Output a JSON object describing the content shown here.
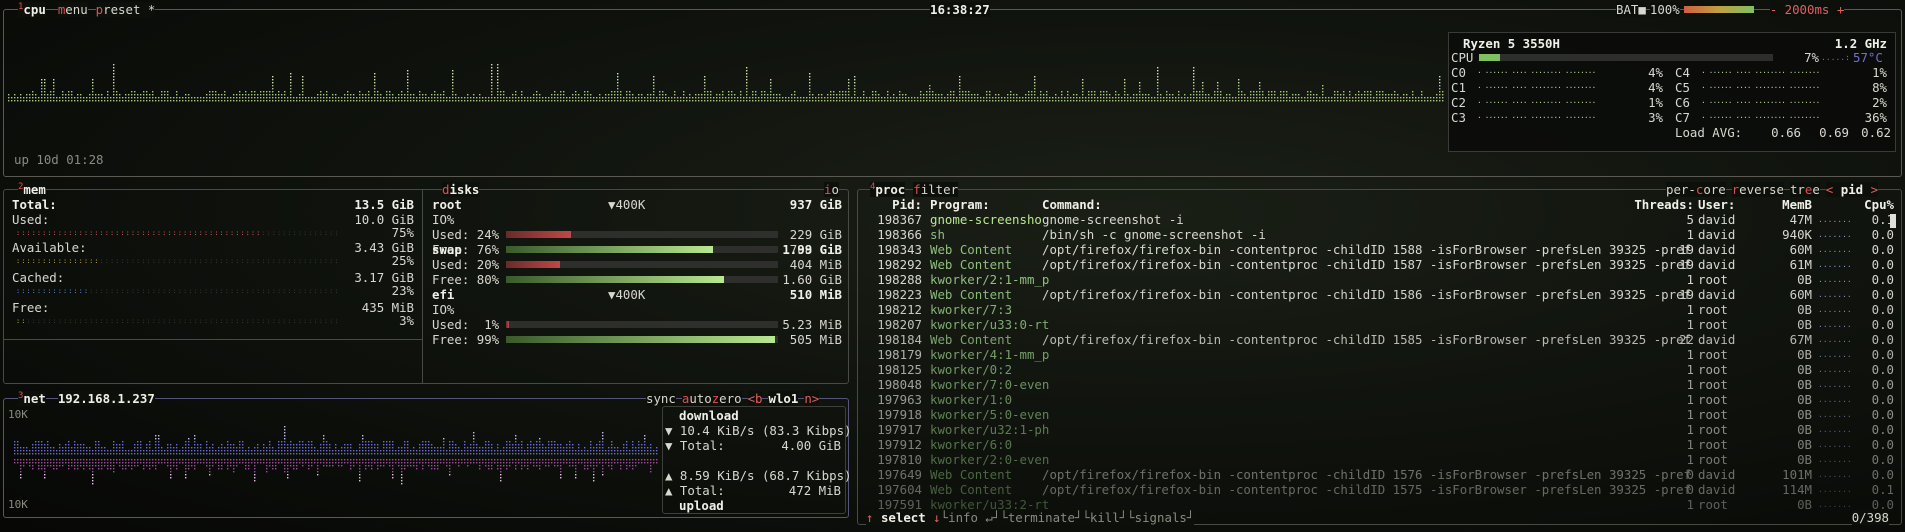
{
  "cpu": {
    "title": "cpu",
    "title_num": "1",
    "menu": "menu",
    "preset": "preset *",
    "clock": "16:38:27",
    "battery_label": "BAT",
    "battery_pct": "100%",
    "battery_fraction": 1.0,
    "interval": "- 2000ms +",
    "uptime": "up 10d 01:28",
    "model": "Ryzen 5 3550H",
    "freq": "1.2 GHz",
    "total": {
      "label": "CPU",
      "pct": "7%",
      "fraction": 0.07,
      "temp": "57°C"
    },
    "cores": [
      {
        "label": "C0",
        "pct": "4%"
      },
      {
        "label": "C1",
        "pct": "4%"
      },
      {
        "label": "C2",
        "pct": "1%"
      },
      {
        "label": "C3",
        "pct": "3%"
      },
      {
        "label": "C4",
        "pct": "1%"
      },
      {
        "label": "C5",
        "pct": "8%"
      },
      {
        "label": "C6",
        "pct": "2%"
      },
      {
        "label": "C7",
        "pct": "36%"
      }
    ],
    "load_label": "Load AVG:",
    "load": [
      "0.66",
      "0.69",
      "0.62"
    ]
  },
  "mem": {
    "title": "mem",
    "title_num": "2",
    "total_label": "Total:",
    "total": "13.5 GiB",
    "used_label": "Used:",
    "used": "10.0 GiB",
    "used_pct": "75%",
    "used_fraction": 0.75,
    "avail_label": "Available:",
    "avail": "3.43 GiB",
    "avail_pct": "25%",
    "avail_fraction": 0.25,
    "cached_label": "Cached:",
    "cached": "3.17 GiB",
    "cached_pct": "23%",
    "cached_fraction": 0.23,
    "free_label": "Free:",
    "free": "435 MiB",
    "free_pct": "3%",
    "free_fraction": 0.03
  },
  "disks": {
    "title": "disks",
    "io": "io",
    "items": [
      {
        "name": "root",
        "io_rate": "▼400K",
        "size": "937 GiB",
        "io_label": "IO%",
        "used_label": "Used: 24%",
        "used": "229 GiB",
        "used_fraction": 0.24,
        "free_label": "Free: 76%",
        "free": "708 GiB",
        "free_fraction": 0.76
      },
      {
        "name": "swap",
        "io_rate": "",
        "size": "1.99 GiB",
        "io_label": "",
        "used_label": "Used: 20%",
        "used": "404 MiB",
        "used_fraction": 0.2,
        "free_label": "Free: 80%",
        "free": "1.60 GiB",
        "free_fraction": 0.8
      },
      {
        "name": "efi",
        "io_rate": "▼400K",
        "size": "510 MiB",
        "io_label": "IO%",
        "used_label": "Used:  1%",
        "used": "5.23 MiB",
        "used_fraction": 0.01,
        "free_label": "Free: 99%",
        "free": "505 MiB",
        "free_fraction": 0.99
      }
    ]
  },
  "net": {
    "title": "net",
    "title_num": "3",
    "ip": "192.168.1.237",
    "sync": "sync",
    "auto": "auto",
    "zero": "zero",
    "prev": "<b",
    "iface": "wlo1",
    "next": "n>",
    "scale_top": "10K",
    "scale_bottom": "10K",
    "download_label": "download",
    "down_rate": "▼ 10.4 KiB/s (83.3 Kibps)",
    "down_total_label": "▼ Total:",
    "down_total": "4.00 GiB",
    "up_rate": "▲ 8.59 KiB/s (68.7 Kibps)",
    "up_total_label": "▲ Total:",
    "up_total": "472 MiB",
    "upload_label": "upload"
  },
  "proc": {
    "title": "proc",
    "title_num": "4",
    "filter": "filter",
    "options": [
      "per-core",
      "reverse",
      "tree",
      "< pid >"
    ],
    "headers": {
      "pid": "Pid:",
      "program": "Program:",
      "command": "Command:",
      "threads": "Threads:",
      "user": "User:",
      "mem": "MemB",
      "cpu": "Cpu%"
    },
    "rows": [
      {
        "pid": "198367",
        "program": "gnome-screensho",
        "command": "gnome-screenshot -i",
        "threads": "5",
        "user": "david",
        "mem": "47M",
        "cpu": "0.1"
      },
      {
        "pid": "198366",
        "program": "sh",
        "command": "/bin/sh -c gnome-screenshot -i",
        "threads": "1",
        "user": "david",
        "mem": "940K",
        "cpu": "0.0"
      },
      {
        "pid": "198343",
        "program": "Web Content",
        "command": "/opt/firefox/firefox-bin -contentproc -childID 1588 -isForBrowser -prefsLen 39325 -pref",
        "threads": "19",
        "user": "david",
        "mem": "60M",
        "cpu": "0.0"
      },
      {
        "pid": "198292",
        "program": "Web Content",
        "command": "/opt/firefox/firefox-bin -contentproc -childID 1587 -isForBrowser -prefsLen 39325 -pref",
        "threads": "19",
        "user": "david",
        "mem": "61M",
        "cpu": "0.0"
      },
      {
        "pid": "198288",
        "program": "kworker/2:1-mm_p",
        "command": "",
        "threads": "1",
        "user": "root",
        "mem": "0B",
        "cpu": "0.0"
      },
      {
        "pid": "198223",
        "program": "Web Content",
        "command": "/opt/firefox/firefox-bin -contentproc -childID 1586 -isForBrowser -prefsLen 39325 -pref",
        "threads": "19",
        "user": "david",
        "mem": "60M",
        "cpu": "0.0"
      },
      {
        "pid": "198212",
        "program": "kworker/7:3",
        "command": "",
        "threads": "1",
        "user": "root",
        "mem": "0B",
        "cpu": "0.0"
      },
      {
        "pid": "198207",
        "program": "kworker/u33:0-rt",
        "command": "",
        "threads": "1",
        "user": "root",
        "mem": "0B",
        "cpu": "0.0"
      },
      {
        "pid": "198184",
        "program": "Web Content",
        "command": "/opt/firefox/firefox-bin -contentproc -childID 1585 -isForBrowser -prefsLen 39325 -pref",
        "threads": "22",
        "user": "david",
        "mem": "67M",
        "cpu": "0.0"
      },
      {
        "pid": "198179",
        "program": "kworker/4:1-mm_p",
        "command": "",
        "threads": "1",
        "user": "root",
        "mem": "0B",
        "cpu": "0.0"
      },
      {
        "pid": "198125",
        "program": "kworker/0:2",
        "command": "",
        "threads": "1",
        "user": "root",
        "mem": "0B",
        "cpu": "0.0"
      },
      {
        "pid": "198048",
        "program": "kworker/7:0-even",
        "command": "",
        "threads": "1",
        "user": "root",
        "mem": "0B",
        "cpu": "0.0"
      },
      {
        "pid": "197963",
        "program": "kworker/1:0",
        "command": "",
        "threads": "1",
        "user": "root",
        "mem": "0B",
        "cpu": "0.0"
      },
      {
        "pid": "197918",
        "program": "kworker/5:0-even",
        "command": "",
        "threads": "1",
        "user": "root",
        "mem": "0B",
        "cpu": "0.0"
      },
      {
        "pid": "197917",
        "program": "kworker/u32:1-ph",
        "command": "",
        "threads": "1",
        "user": "root",
        "mem": "0B",
        "cpu": "0.0"
      },
      {
        "pid": "197912",
        "program": "kworker/6:0",
        "command": "",
        "threads": "1",
        "user": "root",
        "mem": "0B",
        "cpu": "0.0"
      },
      {
        "pid": "197810",
        "program": "kworker/2:0-even",
        "command": "",
        "threads": "1",
        "user": "root",
        "mem": "0B",
        "cpu": "0.0"
      },
      {
        "pid": "197649",
        "program": "Web Content",
        "command": "/opt/firefox/firefox-bin -contentproc -childID 1576 -isForBrowser -prefsLen 39325 -pref",
        "threads": "0",
        "user": "david",
        "mem": "101M",
        "cpu": "0.0"
      },
      {
        "pid": "197604",
        "program": "Web Content",
        "command": "/opt/firefox/firefox-bin -contentproc -childID 1575 -isForBrowser -prefsLen 39325 -pref",
        "threads": "0",
        "user": "david",
        "mem": "114M",
        "cpu": "0.1"
      },
      {
        "pid": "197591",
        "program": "kworker/u33:2-rt",
        "command": "",
        "threads": "1",
        "user": "root",
        "mem": "0B",
        "cpu": "0.0"
      }
    ],
    "footer": {
      "select": "select",
      "info": "info",
      "terminate": "terminate",
      "kill": "kill",
      "signals": "signals",
      "count": "0/398"
    }
  }
}
